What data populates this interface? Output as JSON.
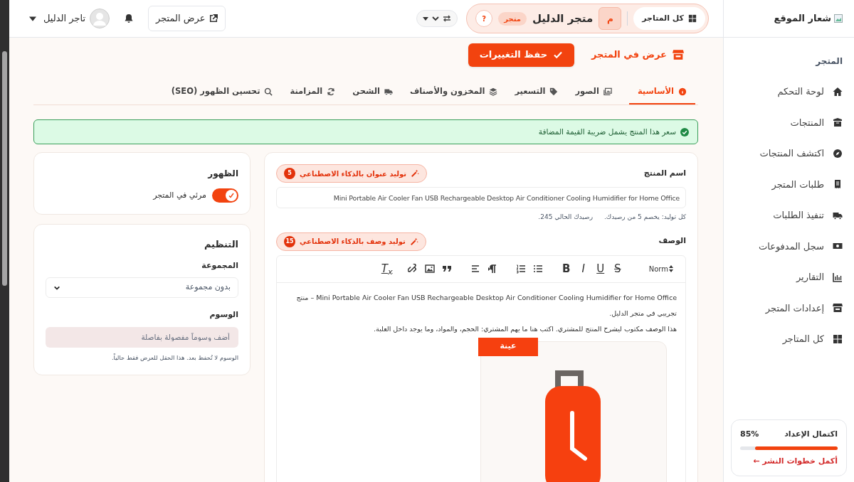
{
  "topbar": {
    "all_stores": "كل المتاجر",
    "store_initial": "م",
    "store_name": "متجر الدليل",
    "store_badge": "متجر",
    "help": "?",
    "view_store": "عرض المتجر",
    "user_name": "تاجر الدليل"
  },
  "actions": {
    "view_in_store": "عرض في المتجر",
    "save": "حفظ التغييرات"
  },
  "tabs": [
    {
      "label": "الأساسية",
      "selected": true
    },
    {
      "label": "الصور",
      "selected": false
    },
    {
      "label": "التسعير",
      "selected": false
    },
    {
      "label": "المخزون والأصناف",
      "selected": false
    },
    {
      "label": "الشحن",
      "selected": false
    },
    {
      "label": "المزامنة",
      "selected": false
    },
    {
      "label": "تحسين الظهور (SEO)",
      "selected": false
    }
  ],
  "alert": "سعر هذا المنتج يشمل ضريبة القيمة المضافة",
  "product": {
    "name_label": "اسم المنتج",
    "ai_title": {
      "label": "توليد عنوان بالذكاء الاصطناعي",
      "count": "5"
    },
    "name_value": "Mini Portable Air Cooler Fan USB Rechargeable Desktop Air Conditioner Cooling Humidifier for Home Office",
    "hint_cost": "كل توليد: يخصم 5 من رصيدك.",
    "hint_balance": "رصيدك الحالي 245.",
    "description_label": "الوصف",
    "ai_description": {
      "label": "توليد وصف بالذكاء الاصطناعي",
      "count": "15"
    },
    "toolbar": {
      "format": "Norm",
      "style_buttons": [
        "S",
        "U",
        "I",
        "B"
      ],
      "clear_button": "T$_{x}$"
    },
    "description_paragraphs": [
      "Mini Portable Air Cooler Fan USB Rechargeable Desktop Air Conditioner Cooling Humidifier for Home Office – منتج تجريبي في متجر الدليل.",
      "هذا الوصف مكتوب ليشرح المنتج للمشتري. اكتب هنا ما يهم المشتري: الحجم، والمواد، وما يوجد داخل العلبة."
    ],
    "image_badge": "عينة"
  },
  "visibility": {
    "title": "الظهور",
    "toggle_label": "مرئي في المتجر",
    "on": true
  },
  "organization": {
    "title": "التنظيم",
    "group_label": "المجموعة",
    "group_value": "بدون مجموعة",
    "tags_label": "الوسوم",
    "tags_placeholder": "أضف وسوماً مفصولة بفاصلة",
    "tags_hint": "الوسوم لا تُحفظ بعد. هذا الحقل للعرض فقط حالياً."
  },
  "sidebar": {
    "logo": "شعار الموقع",
    "section": "المتجر",
    "items": [
      {
        "label": "لوحة التحكم"
      },
      {
        "label": "المنتجات"
      },
      {
        "label": "اكتشف المنتجات"
      },
      {
        "label": "طلبات المتجر"
      },
      {
        "label": "تنفيذ الطلبات"
      },
      {
        "label": "سجل المدفوعات"
      },
      {
        "label": "التقارير"
      },
      {
        "label": "إعدادات المتجر"
      },
      {
        "label": "كل المتاجر"
      }
    ],
    "setup": {
      "title": "اكتمال الإعداد",
      "percent": "85%",
      "level": 0.85,
      "link": "أكمل خطوات النشر ←"
    }
  }
}
